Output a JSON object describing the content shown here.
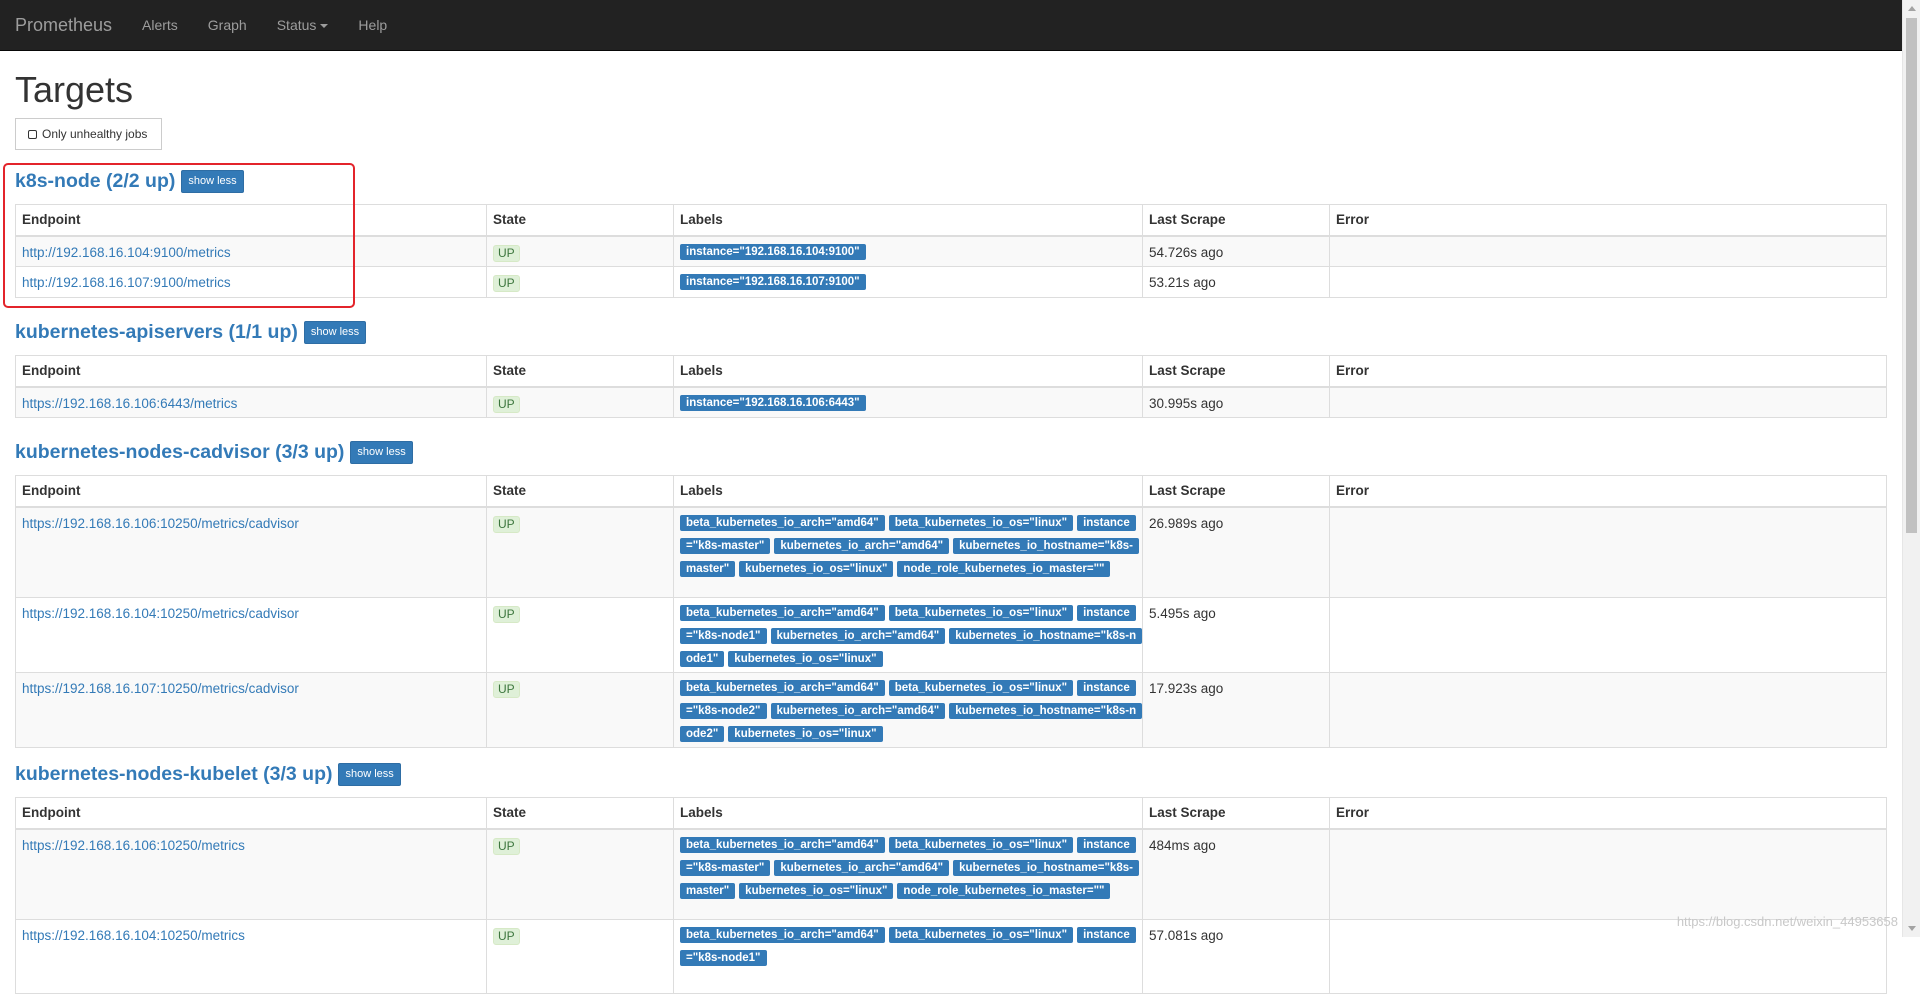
{
  "nav": {
    "brand": "Prometheus",
    "items": [
      "Alerts",
      "Graph",
      "Status",
      "Help"
    ]
  },
  "page": {
    "title": "Targets",
    "filter_label": "Only unhealthy jobs"
  },
  "table_headers": {
    "endpoint": "Endpoint",
    "state": "State",
    "labels": "Labels",
    "last_scrape": "Last Scrape",
    "error": "Error"
  },
  "jobs": [
    {
      "title": "k8s-node (2/2 up)",
      "toggle": "show less",
      "rows": [
        {
          "endpoint": "http://192.168.16.104:9100/metrics",
          "state": "UP",
          "labels": [
            "instance=\"192.168.16.104:9100\""
          ],
          "last_scrape": "54.726s ago",
          "error": ""
        },
        {
          "endpoint": "http://192.168.16.107:9100/metrics",
          "state": "UP",
          "labels": [
            "instance=\"192.168.16.107:9100\""
          ],
          "last_scrape": "53.21s ago",
          "error": ""
        }
      ]
    },
    {
      "title": "kubernetes-apiservers (1/1 up)",
      "toggle": "show less",
      "rows": [
        {
          "endpoint": "https://192.168.16.106:6443/metrics",
          "state": "UP",
          "labels": [
            "instance=\"192.168.16.106:6443\""
          ],
          "last_scrape": "30.995s ago",
          "error": ""
        }
      ]
    },
    {
      "title": "kubernetes-nodes-cadvisor (3/3 up)",
      "toggle": "show less",
      "rows": [
        {
          "endpoint": "https://192.168.16.106:10250/metrics/cadvisor",
          "state": "UP",
          "labels": [
            "beta_kubernetes_io_arch=\"amd64\"",
            "beta_kubernetes_io_os=\"linux\"",
            "instance=\"k8s-master\"",
            "kubernetes_io_arch=\"amd64\"",
            "kubernetes_io_hostname=\"k8s-master\"",
            "kubernetes_io_os=\"linux\"",
            "node_role_kubernetes_io_master=\"\""
          ],
          "last_scrape": "26.989s ago",
          "error": ""
        },
        {
          "endpoint": "https://192.168.16.104:10250/metrics/cadvisor",
          "state": "UP",
          "labels": [
            "beta_kubernetes_io_arch=\"amd64\"",
            "beta_kubernetes_io_os=\"linux\"",
            "instance=\"k8s-node1\"",
            "kubernetes_io_arch=\"amd64\"",
            "kubernetes_io_hostname=\"k8s-node1\"",
            "kubernetes_io_os=\"linux\""
          ],
          "last_scrape": "5.495s ago",
          "error": ""
        },
        {
          "endpoint": "https://192.168.16.107:10250/metrics/cadvisor",
          "state": "UP",
          "labels": [
            "beta_kubernetes_io_arch=\"amd64\"",
            "beta_kubernetes_io_os=\"linux\"",
            "instance=\"k8s-node2\"",
            "kubernetes_io_arch=\"amd64\"",
            "kubernetes_io_hostname=\"k8s-node2\"",
            "kubernetes_io_os=\"linux\""
          ],
          "last_scrape": "17.923s ago",
          "error": ""
        }
      ]
    },
    {
      "title": "kubernetes-nodes-kubelet (3/3 up)",
      "toggle": "show less",
      "rows": [
        {
          "endpoint": "https://192.168.16.106:10250/metrics",
          "state": "UP",
          "labels": [
            "beta_kubernetes_io_arch=\"amd64\"",
            "beta_kubernetes_io_os=\"linux\"",
            "instance=\"k8s-master\"",
            "kubernetes_io_arch=\"amd64\"",
            "kubernetes_io_hostname=\"k8s-master\"",
            "kubernetes_io_os=\"linux\"",
            "node_role_kubernetes_io_master=\"\""
          ],
          "last_scrape": "484ms ago",
          "error": ""
        },
        {
          "endpoint": "https://192.168.16.104:10250/metrics",
          "state": "UP",
          "labels": [
            "beta_kubernetes_io_arch=\"amd64\"",
            "beta_kubernetes_io_os=\"linux\"",
            "instance=\"k8s-node1\""
          ],
          "last_scrape": "57.081s ago",
          "error": ""
        }
      ]
    }
  ],
  "watermark": "https://blog.csdn.net/weixin_44953658"
}
